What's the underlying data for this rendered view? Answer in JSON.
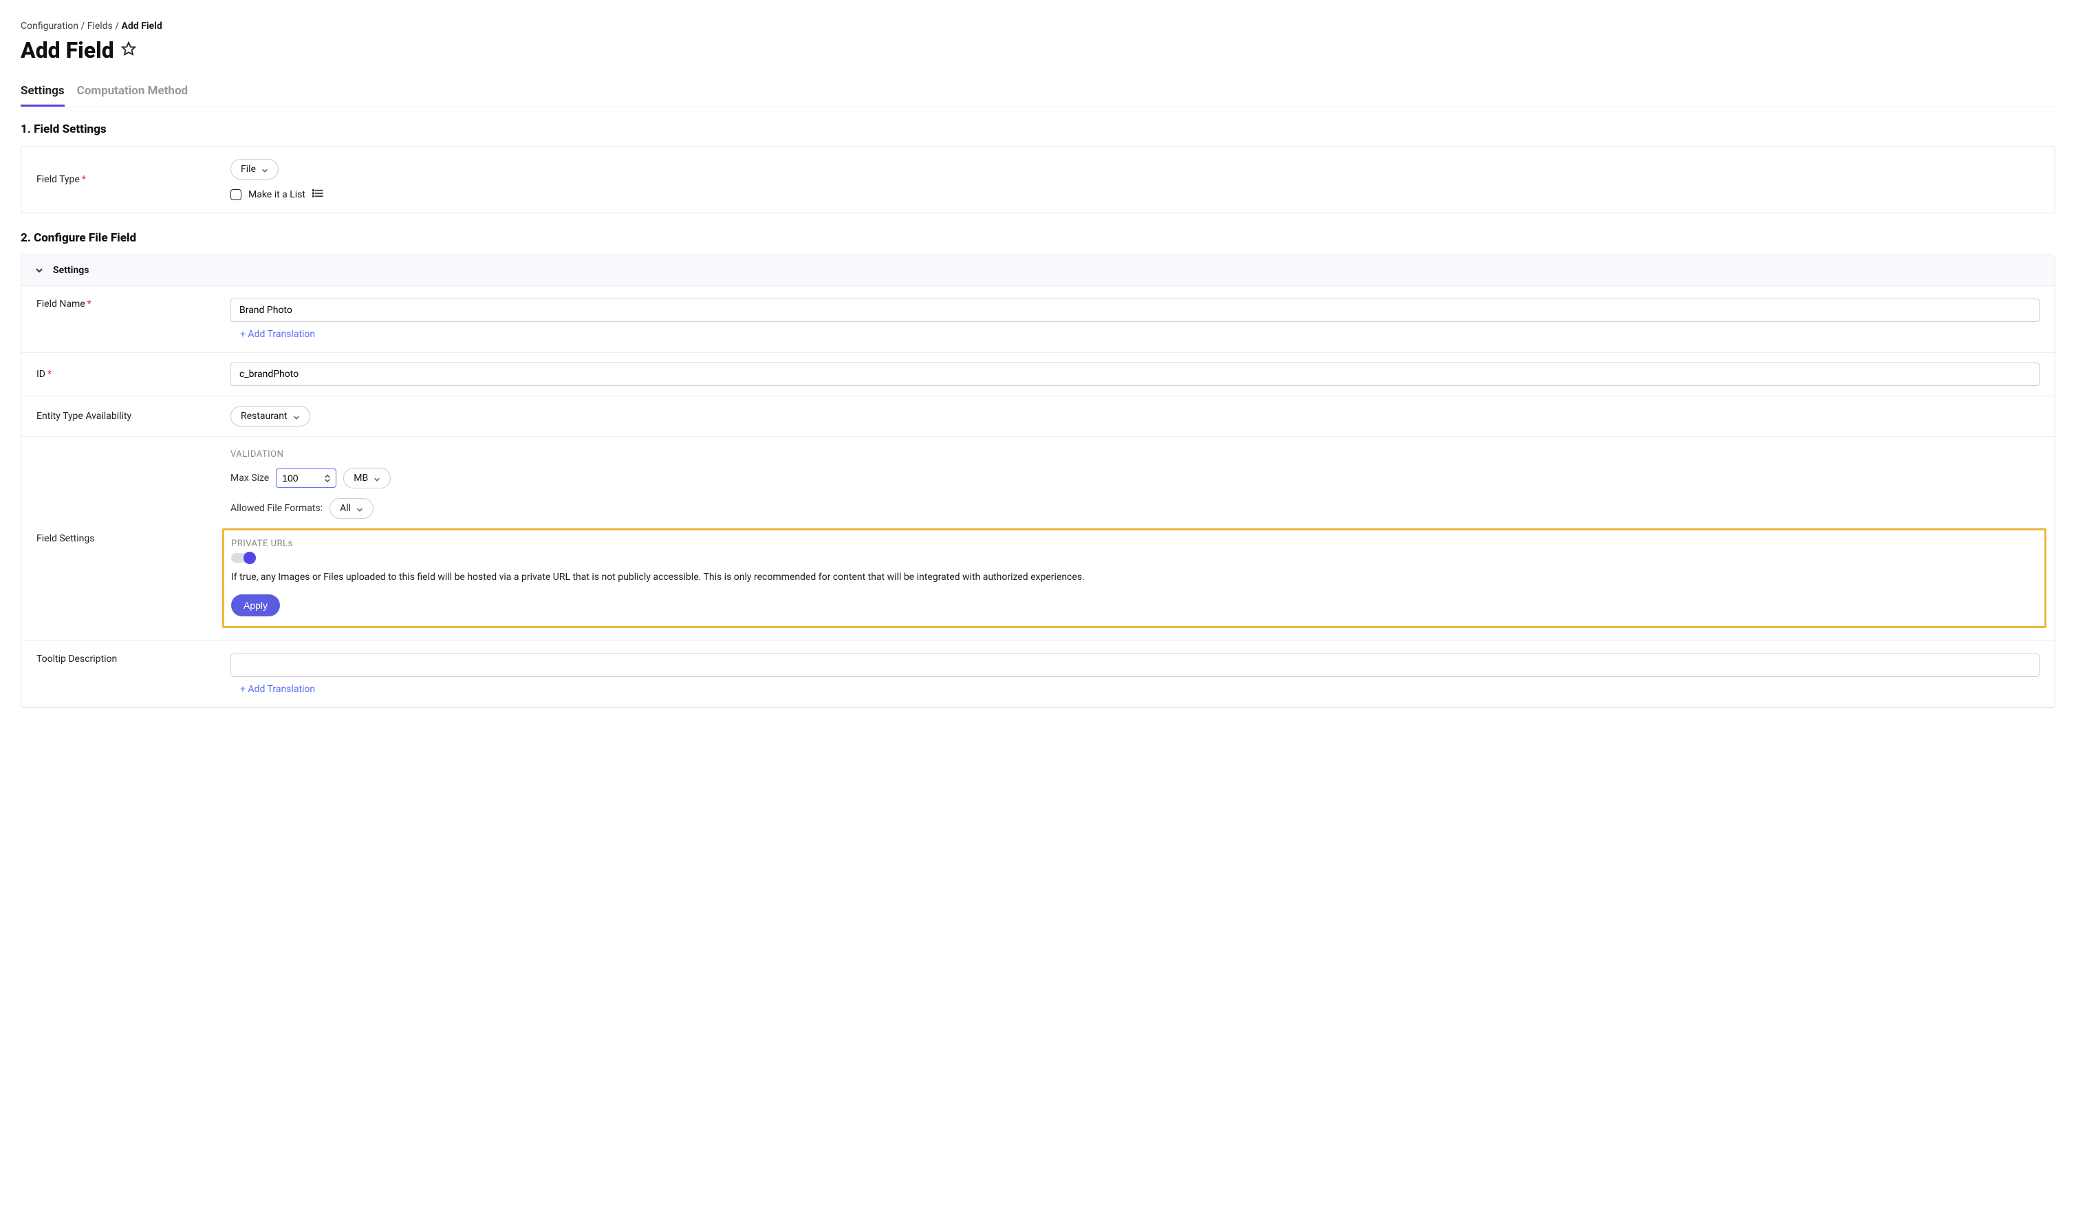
{
  "breadcrumb": {
    "item1": "Configuration",
    "item2": "Fields",
    "item3": "Add Field",
    "sep": " / "
  },
  "page_title": "Add Field",
  "tabs": {
    "settings": "Settings",
    "computation": "Computation Method"
  },
  "section1": {
    "heading": "1. Field Settings",
    "field_type_label": "Field Type",
    "field_type_value": "File",
    "make_list_label": "Make it a List"
  },
  "section2": {
    "heading": "2. Configure File Field",
    "accordion_title": "Settings",
    "field_name": {
      "label": "Field Name",
      "value": "Brand Photo",
      "add_translation": "+ Add Translation"
    },
    "id": {
      "label": "ID",
      "value": "c_brandPhoto"
    },
    "entity": {
      "label": "Entity Type Availability",
      "value": "Restaurant"
    },
    "settings": {
      "label": "Field Settings",
      "validation_heading": "VALIDATION",
      "max_size_label": "Max Size",
      "max_size_value": "100",
      "size_unit": "MB",
      "allowed_formats_label": "Allowed File Formats:",
      "allowed_formats_value": "All",
      "private_urls_heading": "PRIVATE URLs",
      "private_urls_help": "If true, any Images or Files uploaded to this field will be hosted via a private URL that is not publicly accessible. This is only recommended for content that will be integrated with authorized experiences.",
      "apply_label": "Apply"
    },
    "tooltip": {
      "label": "Tooltip Description",
      "value": "",
      "add_translation": "+ Add Translation"
    }
  }
}
